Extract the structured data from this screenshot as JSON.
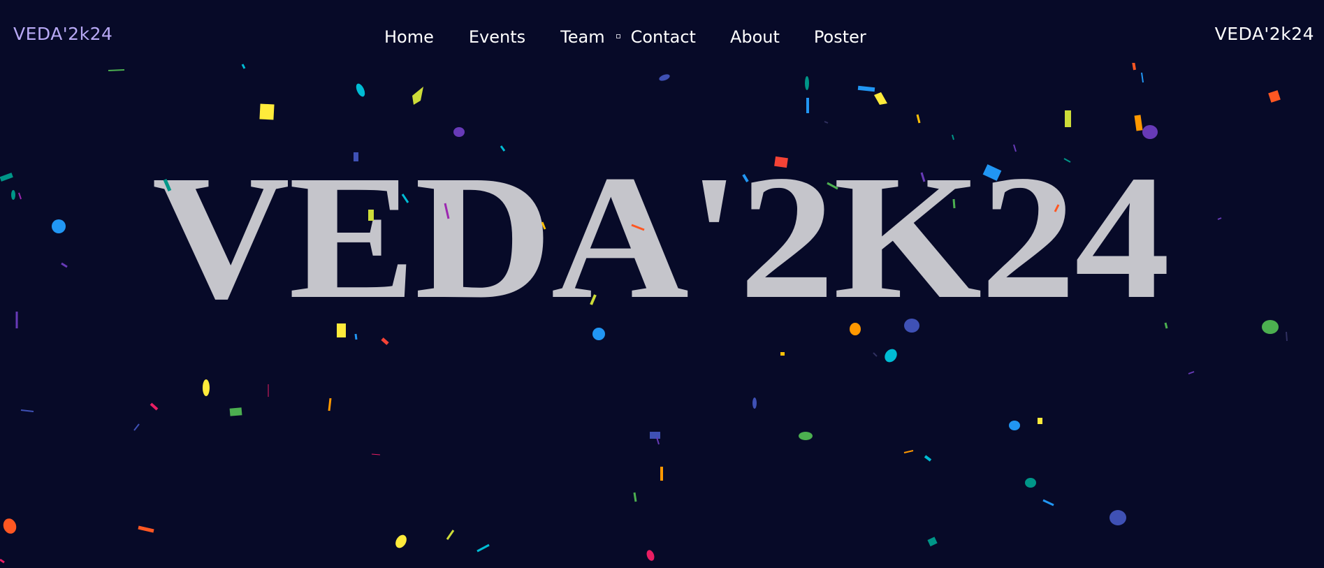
{
  "header": {
    "brand_left": "VEDA'2k24",
    "brand_right": "VEDA'2k24",
    "nav": {
      "home": "Home",
      "events": "Events",
      "team": "Team",
      "contact": "Contact",
      "about": "About",
      "poster": "Poster"
    }
  },
  "hero": {
    "title": "VEDA'2K24"
  },
  "colors": {
    "background": "#070a28",
    "brand_left": "#b8a9f5",
    "nav_text": "#ffffff",
    "hero_text": "#c5c5cb"
  },
  "decorations": {
    "confetti_icon": "confetti-pieces"
  }
}
